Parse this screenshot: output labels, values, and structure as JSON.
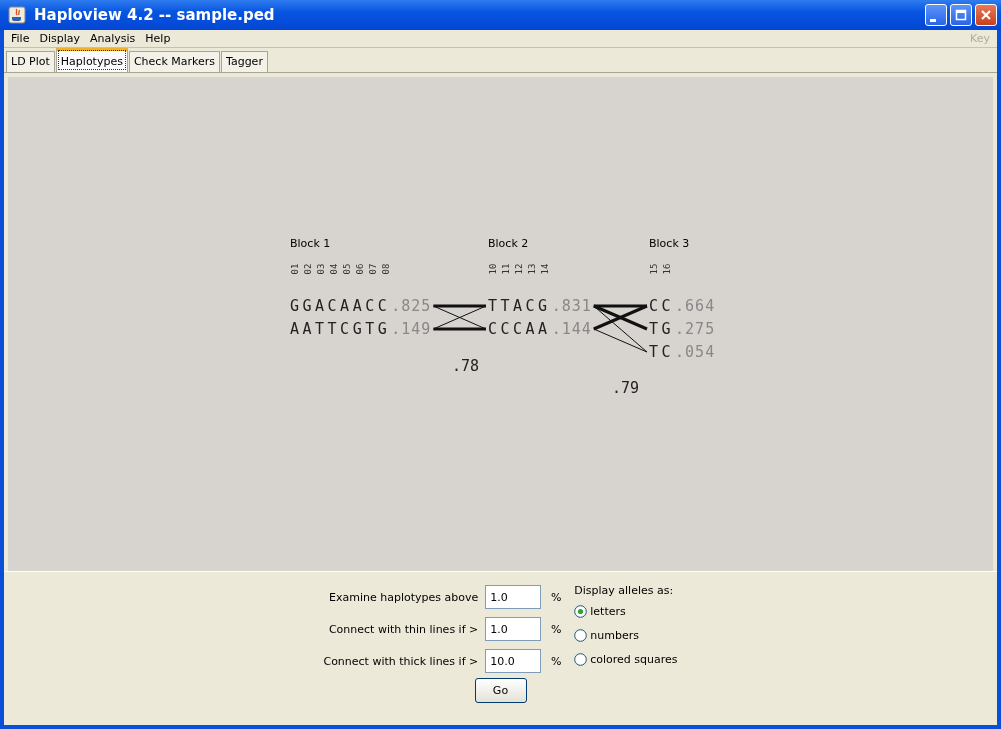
{
  "window": {
    "title": "Haploview 4.2 -- sample.ped"
  },
  "menu": [
    {
      "label": "File",
      "disabled": false
    },
    {
      "label": "Display",
      "disabled": false
    },
    {
      "label": "Analysis",
      "disabled": false
    },
    {
      "label": "Help",
      "disabled": false
    }
  ],
  "menu_right": {
    "label": "Key",
    "disabled": true
  },
  "tabs": [
    {
      "label": "LD Plot",
      "selected": false
    },
    {
      "label": "Haplotypes",
      "selected": true
    },
    {
      "label": "Check Markers",
      "selected": false
    },
    {
      "label": "Tagger",
      "selected": false
    }
  ],
  "blocks": [
    {
      "title": "Block 1",
      "markers": [
        "01",
        "02",
        "03",
        "04",
        "05",
        "06",
        "07",
        "08"
      ],
      "haplotypes": [
        {
          "alleles": "GGACAACC",
          "frequency": ".825",
          "links": [
            {
              "kind": "thick"
            },
            {
              "kind": "thin"
            }
          ]
        },
        {
          "alleles": "AATTCGTG",
          "frequency": ".149",
          "links": [
            {
              "kind": "thin"
            },
            {
              "kind": "thick"
            }
          ]
        }
      ],
      "multiallelic_d": ".78"
    },
    {
      "title": "Block 2",
      "markers": [
        "10",
        "11",
        "12",
        "13",
        "14"
      ],
      "haplotypes": [
        {
          "alleles": "TTACG",
          "frequency": ".831",
          "links": [
            {
              "kind": "thick"
            },
            {
              "kind": "thick"
            },
            {
              "kind": "thin"
            }
          ]
        },
        {
          "alleles": "CCCAA",
          "frequency": ".144",
          "links": [
            {
              "kind": "thick"
            },
            {
              "kind": "none"
            },
            {
              "kind": "thin"
            }
          ]
        }
      ],
      "multiallelic_d": ".79"
    },
    {
      "title": "Block 3",
      "markers": [
        "15",
        "16"
      ],
      "haplotypes": [
        {
          "alleles": "CC",
          "frequency": ".664"
        },
        {
          "alleles": "TG",
          "frequency": ".275"
        },
        {
          "alleles": "TC",
          "frequency": ".054"
        }
      ]
    }
  ],
  "settings": [
    {
      "label": "Examine haplotypes above",
      "value": "1.0",
      "unit": "%"
    },
    {
      "label": "Connect with thin lines if >",
      "value": "1.0",
      "unit": "%"
    },
    {
      "label": "Connect with thick lines if >",
      "value": "10.0",
      "unit": "%"
    }
  ],
  "display_alleles": {
    "label": "Display alleles as:",
    "options": [
      {
        "label": "letters",
        "selected": true
      },
      {
        "label": "numbers",
        "selected": false
      },
      {
        "label": "colored squares",
        "selected": false
      }
    ]
  },
  "go_button": "Go"
}
